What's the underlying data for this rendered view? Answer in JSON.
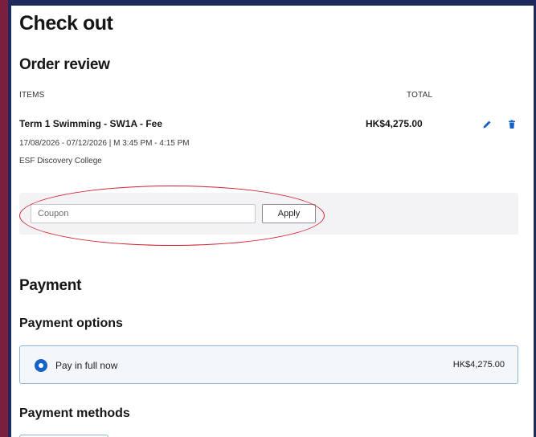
{
  "page": {
    "title": "Check out"
  },
  "order_review": {
    "heading": "Order review",
    "columns": {
      "items": "ITEMS",
      "total": "TOTAL"
    },
    "item": {
      "name": "Term 1 Swimming - SW1A - Fee",
      "price": "HK$4,275.00",
      "schedule": "17/08/2026 - 07/12/2026 | M 3:45 PM - 4:15 PM",
      "location": "ESF Discovery College",
      "edit_icon": "pencil-icon",
      "delete_icon": "trash-icon"
    },
    "coupon": {
      "placeholder": "Coupon",
      "value": "",
      "apply_label": "Apply"
    }
  },
  "payment": {
    "heading": "Payment",
    "options_heading": "Payment options",
    "option": {
      "label": "Pay in full now",
      "amount": "HK$4,275.00",
      "selected": true
    },
    "methods_heading": "Payment methods"
  },
  "colors": {
    "accent": "#1762c6",
    "highlight": "#d21f2b",
    "frame_left": "#7a1f3d",
    "frame_border": "#1f2a5c",
    "panel_bg": "#f3f3f6",
    "option_border": "#8fb2d8"
  }
}
